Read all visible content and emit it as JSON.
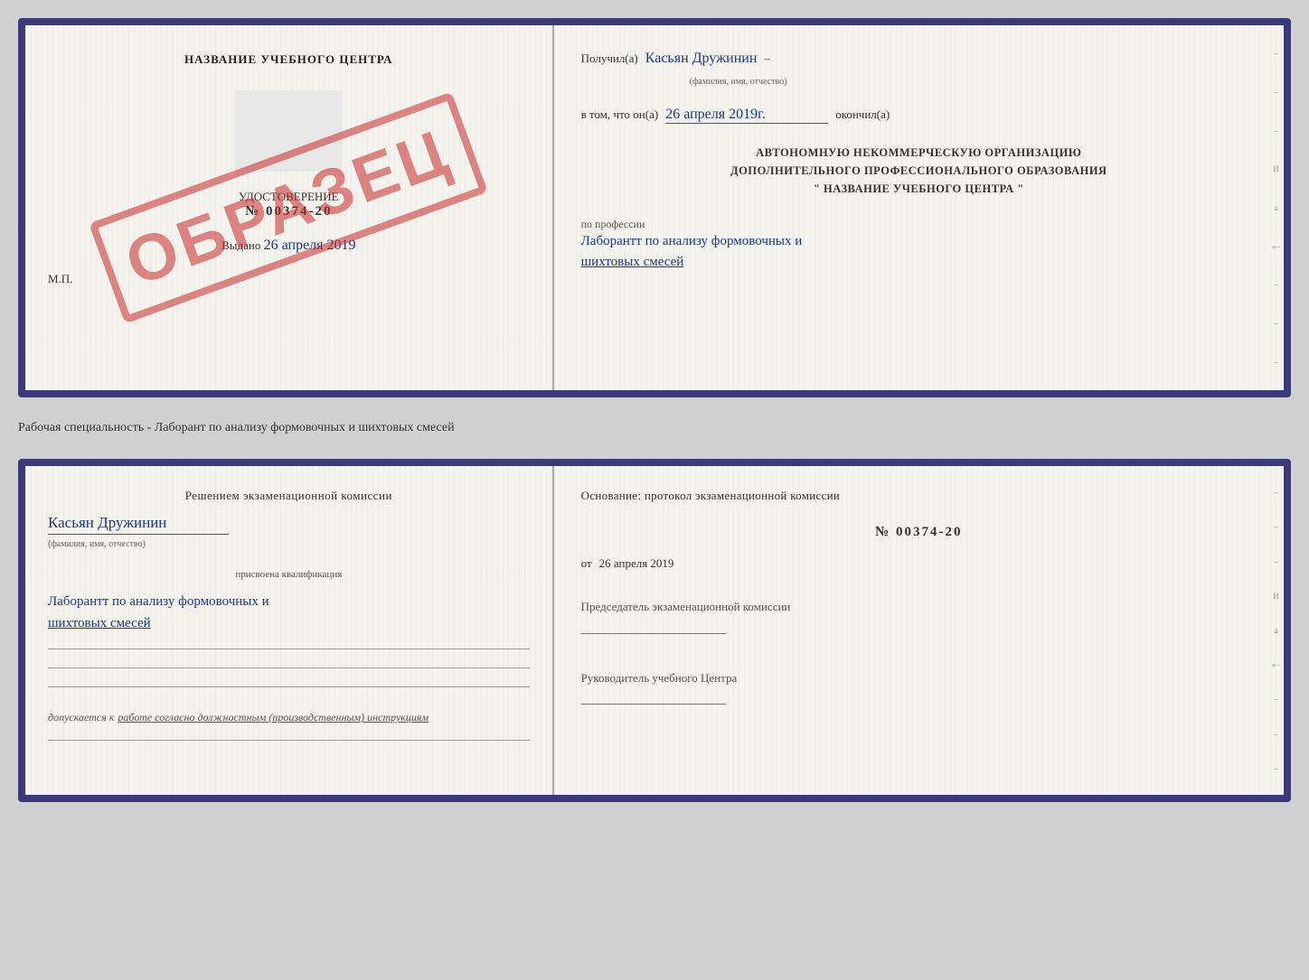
{
  "topCard": {
    "left": {
      "title": "НАЗВАНИЕ УЧЕБНОГО ЦЕНТРА",
      "stamp": "ОБРАЗЕЦ",
      "certLabel": "УДОСТОВЕРЕНИЕ",
      "certNumber": "№ 00374-20",
      "issuedLabel": "Выдано",
      "issuedDate": "26 апреля 2019",
      "mp": "М.П."
    },
    "right": {
      "receivedLabel": "Получил(а)",
      "receivedName": "Касьян Дружинин",
      "fioSubLabel": "(фамилия, имя, отчество)",
      "dash": "–",
      "completedPrefixLabel": "в том, что он(а)",
      "completedDate": "26 апреля 2019г.",
      "completedSuffix": "окончил(а)",
      "orgBlock1": "АВТОНОМНУЮ НЕКОММЕРЧЕСКУЮ ОРГАНИЗАЦИЮ",
      "orgBlock2": "ДОПОЛНИТЕЛЬНОГО ПРОФЕССИОНАЛЬНОГО ОБРАЗОВАНИЯ",
      "orgBlock3": "\"   НАЗВАНИЕ УЧЕБНОГО ЦЕНТРА   \"",
      "professionLabel": "по профессии",
      "profession1": "Лаборантт по анализу формовочных и",
      "profession2": "шихтовых смесей"
    }
  },
  "middleText": "Рабочая специальность - Лаборант по анализу формовочных и шихтовых смесей",
  "bottomCard": {
    "left": {
      "decisionLabel": "Решением экзаменационной комиссии",
      "name": "Касьян Дружинин",
      "fioSubLabel": "(фамилия, имя, отчество)",
      "qualificationLabel": "присвоена квалификация",
      "profession1": "Лаборантт по анализу формовочных и",
      "profession2": "шихтовых смесей",
      "допускLabel": "допускается к",
      "допускText": "работе согласно должностным (производственным) инструкциям"
    },
    "right": {
      "basisLabel": "Основание: протокол экзаменационной комиссии",
      "number": "№ 00374-20",
      "fromLabel": "от",
      "fromDate": "26 апреля 2019",
      "chairmanLabel": "Председатель экзаменационной комиссии",
      "directorLabel": "Руководитель учебного Центра"
    },
    "sideChars": [
      "–",
      "–",
      "–",
      "И",
      "ą",
      "«–",
      "–",
      "–",
      "–"
    ]
  }
}
